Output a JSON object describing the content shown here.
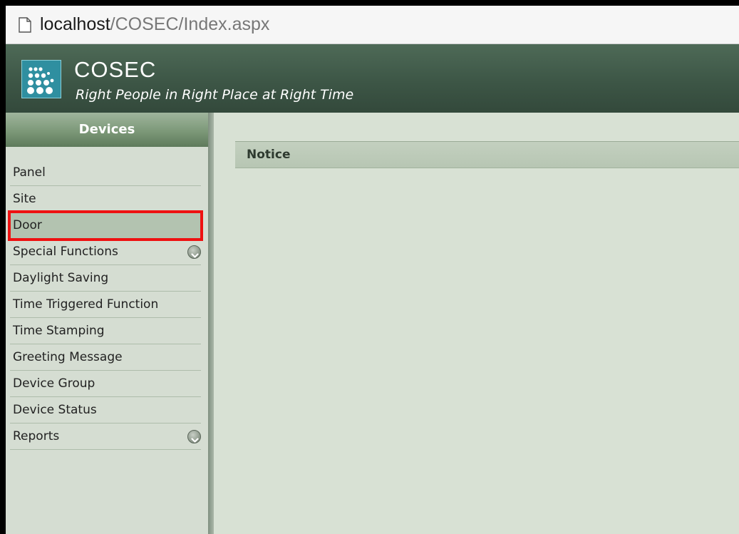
{
  "browser": {
    "url_host": "localhost",
    "url_path": "/COSEC/Index.aspx",
    "page_icon": "page-icon"
  },
  "header": {
    "logo_icon": "dots-logo-icon",
    "title": "COSEC",
    "tagline": "Right People in Right Place at Right Time"
  },
  "sidebar": {
    "title": "Devices",
    "items": [
      {
        "label": "Panel",
        "expandable": false,
        "selected": false
      },
      {
        "label": "Site",
        "expandable": false,
        "selected": false
      },
      {
        "label": "Door",
        "expandable": false,
        "selected": true
      },
      {
        "label": "Special Functions",
        "expandable": true,
        "selected": false
      },
      {
        "label": "Daylight Saving",
        "expandable": false,
        "selected": false
      },
      {
        "label": "Time Triggered Function",
        "expandable": false,
        "selected": false
      },
      {
        "label": "Time Stamping",
        "expandable": false,
        "selected": false
      },
      {
        "label": "Greeting Message",
        "expandable": false,
        "selected": false
      },
      {
        "label": "Device Group",
        "expandable": false,
        "selected": false
      },
      {
        "label": "Device Status",
        "expandable": false,
        "selected": false
      },
      {
        "label": "Reports",
        "expandable": true,
        "selected": false
      }
    ]
  },
  "main": {
    "notice_title": "Notice"
  },
  "colors": {
    "header_bg": "#3d5646",
    "sidebar_bg": "#d5ddd2",
    "main_bg": "#d8e1d4",
    "highlight_border": "#ee1111"
  }
}
